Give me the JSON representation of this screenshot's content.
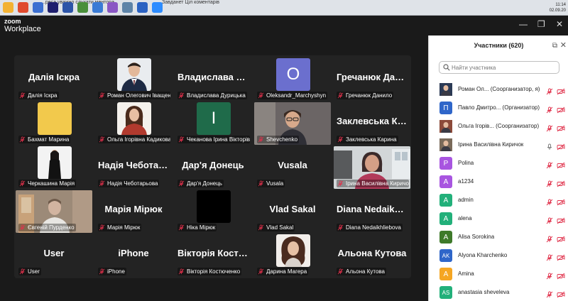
{
  "taskbar": {
    "items": [
      {
        "color": "#f3b233"
      },
      {
        "color": "#e04a2e"
      },
      {
        "color": "#3b6fd1"
      },
      {
        "color": "#1f1f6e"
      },
      {
        "color": "#2c54a8"
      },
      {
        "color": "#4a8f3a"
      },
      {
        "color": "#3a7bd5"
      },
      {
        "color": "#8a57c4"
      },
      {
        "color": "#5e84a8"
      },
      {
        "color": "#2b62c2"
      },
      {
        "color": "#2d8cff"
      }
    ],
    "snippet_1": "...реса уважно слухати ментора",
    "snippet_2": "Завданет Ціл коментарів",
    "clock_time": "11:14",
    "clock_date": "02.09.20"
  },
  "app": {
    "logo_top": "zoom",
    "logo_bottom": "Workplace"
  },
  "window": {
    "minimize": "—",
    "maximize": "❐",
    "close": "✕"
  },
  "tiles": [
    {
      "name": "Далія Іскра",
      "label": "Далія Іскра",
      "kind": "name"
    },
    {
      "name": "",
      "label": "Роман Олегович Іващен...",
      "kind": "photo",
      "photo": "man-suit"
    },
    {
      "name": "Владислава Ду...",
      "label": "Владислава Дурицька",
      "kind": "name"
    },
    {
      "name": "",
      "label": "Oleksandr_Marchyshyn",
      "kind": "avatar",
      "letter": "O",
      "color": "#6b6fce"
    },
    {
      "name": "Гречанюк Дан...",
      "label": "Гречанюк Данило",
      "kind": "name"
    },
    {
      "name": "",
      "label": "Бахмат Марина",
      "kind": "avatar",
      "letter": "",
      "color": "#f2c94c"
    },
    {
      "name": "",
      "label": "Ольга Ігорівна Кадикова",
      "kind": "photo",
      "photo": "woman-red"
    },
    {
      "name": "",
      "label": "Чеканова Ірина Вікторів...",
      "kind": "avatar",
      "letter": "I",
      "color": "#1f6b4a"
    },
    {
      "name": "",
      "label": "Shevchenko",
      "kind": "video",
      "photo": "woman-glasses"
    },
    {
      "name": "Заклевська Ка...",
      "label": "Заклевська Карина",
      "kind": "name"
    },
    {
      "name": "",
      "label": "Черкашина Марія",
      "kind": "photo",
      "photo": "woman-dark"
    },
    {
      "name": "Надія Чеботар...",
      "label": "Надія Чеботарьова",
      "kind": "name"
    },
    {
      "name": "Дар'я Донець",
      "label": "Дар'я Донець",
      "kind": "name"
    },
    {
      "name": "Vusala",
      "label": "Vusala",
      "kind": "name"
    },
    {
      "name": "",
      "label": "Ірина Василівна Киричок",
      "kind": "video",
      "photo": "woman-office",
      "active": true
    },
    {
      "name": "",
      "label": "Євгеній Пурденко",
      "kind": "video",
      "photo": "man-room"
    },
    {
      "name": "Марія Мірюк",
      "label": "Марія Мірюк",
      "kind": "name"
    },
    {
      "name": "",
      "label": "Ніка Мірюк",
      "kind": "avatar",
      "letter": "",
      "color": "#000000"
    },
    {
      "name": "Vlad Sakal",
      "label": "Vlad Sakal",
      "kind": "name"
    },
    {
      "name": "Diana Nedaikhli...",
      "label": "Diana Nedaikhliebova",
      "kind": "name"
    },
    {
      "name": "User",
      "label": "User",
      "kind": "name"
    },
    {
      "name": "iPhone",
      "label": "iPhone",
      "kind": "name"
    },
    {
      "name": "Вікторія Костю...",
      "label": "Вікторія Костюченко",
      "kind": "name"
    },
    {
      "name": "",
      "label": "Дарина Магера",
      "kind": "photo",
      "photo": "girl-curly"
    },
    {
      "name": "Альона Кутова",
      "label": "Альона Кутова",
      "kind": "name"
    }
  ],
  "panel": {
    "title": "Участники (620)",
    "search_placeholder": "Найти участника",
    "participants": [
      {
        "name": "Роман Ол...",
        "role": " (Соорганизатор, я)",
        "avatar": "photo",
        "letter": "",
        "color": "#2b3a55",
        "mic_on": false,
        "cam_on": false
      },
      {
        "name": "Павло Дмитро...",
        "role": " (Организатор)",
        "avatar": "letter",
        "letter": "П",
        "color": "#2f66c9",
        "mic_on": false,
        "cam_on": false
      },
      {
        "name": "Ольга Ігорів...",
        "role": " (Соорганизатор)",
        "avatar": "photo",
        "letter": "",
        "color": "#8c4a3a",
        "mic_on": false,
        "cam_on": false
      },
      {
        "name": "Ірина Василівна Киричок",
        "role": "",
        "avatar": "photo",
        "letter": "",
        "color": "#7a6a5a",
        "mic_on": true,
        "cam_on": false
      },
      {
        "name": "Polina",
        "role": "",
        "avatar": "letter",
        "letter": "P",
        "color": "#a855e0",
        "mic_on": false,
        "cam_on": false
      },
      {
        "name": "a1234",
        "role": "",
        "avatar": "letter",
        "letter": "A",
        "color": "#a855e0",
        "mic_on": false,
        "cam_on": false
      },
      {
        "name": "admin",
        "role": "",
        "avatar": "letter",
        "letter": "A",
        "color": "#22b07a",
        "mic_on": false,
        "cam_on": false
      },
      {
        "name": "alena",
        "role": "",
        "avatar": "letter",
        "letter": "A",
        "color": "#22b07a",
        "mic_on": false,
        "cam_on": false
      },
      {
        "name": "Alisa Sorokina",
        "role": "",
        "avatar": "letter",
        "letter": "A",
        "color": "#3e7a2a",
        "mic_on": false,
        "cam_on": false
      },
      {
        "name": "Alyona Kharchenko",
        "role": "",
        "avatar": "letter",
        "letter": "AK",
        "color": "#2f66c9",
        "mic_on": false,
        "cam_on": false
      },
      {
        "name": "Amina",
        "role": "",
        "avatar": "letter",
        "letter": "A",
        "color": "#f5a623",
        "mic_on": false,
        "cam_on": false
      },
      {
        "name": "anastasia sheveleva",
        "role": "",
        "avatar": "letter",
        "letter": "AS",
        "color": "#22b07a",
        "mic_on": false,
        "cam_on": false
      }
    ]
  },
  "colors": {
    "muted_red": "#e0314b",
    "active_border": "#3ad08a",
    "stage_bg": "#232323"
  }
}
